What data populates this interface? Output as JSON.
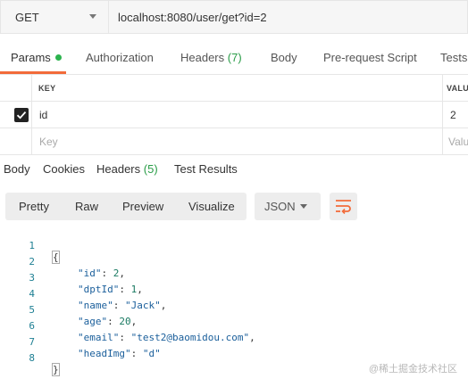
{
  "request": {
    "method": "GET",
    "url": "localhost:8080/user/get?id=2"
  },
  "request_tabs": [
    {
      "label": "Params",
      "count": "",
      "active": true
    },
    {
      "label": "Authorization",
      "count": ""
    },
    {
      "label": "Headers",
      "count": "(7)"
    },
    {
      "label": "Body",
      "count": ""
    },
    {
      "label": "Pre-request Script",
      "count": ""
    },
    {
      "label": "Tests",
      "count": ""
    }
  ],
  "params": {
    "headers": {
      "key": "KEY",
      "value": "VALU"
    },
    "rows": [
      {
        "checked": true,
        "key": "id",
        "value": "2"
      }
    ],
    "new_row": {
      "key_placeholder": "Key",
      "value_placeholder": "Valu"
    }
  },
  "response_tabs": [
    {
      "label": "Body",
      "count": ""
    },
    {
      "label": "Cookies",
      "count": ""
    },
    {
      "label": "Headers",
      "count": "(5)"
    },
    {
      "label": "Test Results",
      "count": ""
    }
  ],
  "toolbar": {
    "views": [
      "Pretty",
      "Raw",
      "Preview",
      "Visualize"
    ],
    "format": "JSON"
  },
  "code_lines": [
    {
      "n": "1",
      "text": "{"
    },
    {
      "n": "2",
      "key": "\"id\"",
      "value": "2",
      "type": "num",
      "comma": true
    },
    {
      "n": "3",
      "key": "\"dptId\"",
      "value": "1",
      "type": "num",
      "comma": true
    },
    {
      "n": "4",
      "key": "\"name\"",
      "value": "\"Jack\"",
      "type": "str",
      "comma": true
    },
    {
      "n": "5",
      "key": "\"age\"",
      "value": "20",
      "type": "num",
      "comma": true
    },
    {
      "n": "6",
      "key": "\"email\"",
      "value": "\"test2@baomidou.com\"",
      "type": "str",
      "comma": true
    },
    {
      "n": "7",
      "key": "\"headImg\"",
      "value": "\"d\"",
      "type": "str",
      "comma": false
    },
    {
      "n": "8",
      "text": "}"
    }
  ],
  "watermark": "@稀土掘金技术社区",
  "colors": {
    "accent": "#f26b3a",
    "count_green": "#2a9d48",
    "status_dot": "#2cb34e"
  }
}
